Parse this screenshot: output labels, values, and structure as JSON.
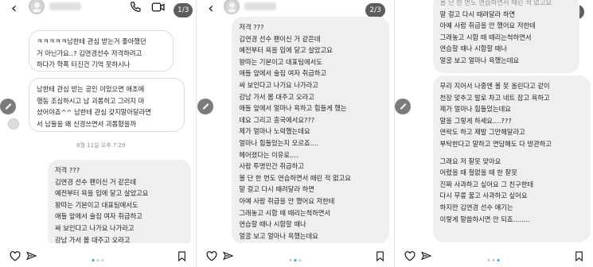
{
  "panels": [
    {
      "page": "1/3",
      "timestamp": "8월 11일 오후 7:29",
      "bubbles": [
        [
          "ㅋㅋㅋㅋㅋ남한테 관심 받는거 좋아했던",
          "거 아닌가요..? 김연경선수 저격하려고",
          "하다가 학폭 터진건 기억 못하시나"
        ],
        [
          "남한테 관심 받는 공인 이었으면 애초에",
          "행동 조심하시고 남 괴롭히고 그러지 마",
          "셨어야죠^^ 남한테 관심 갖지말아달라면",
          "서 남들을 왜 신경쓰면서 괴롭혔을까"
        ],
        [
          "저격 ???",
          "김연경 선수 팬이신 거 같은데",
          "예전부터 욕을 입에 달고 살았고요",
          "왕따는 기본이고 대표팀에서도",
          "애들 앞에서 술집 여자 취급하고",
          "싸 보인다고 나가요 나가라고",
          "강남 가서 몸 대주고 오라고"
        ]
      ]
    },
    {
      "page": "2/3",
      "bubbles": [
        [
          "저격 ???",
          "김연경 선수 팬이신 거 같은데",
          "예전부터 욕을 입에 달고 살았고요",
          "왕따는 기본이고 대표팀에서도",
          "애들 앞에서 술집 여자 취급하고",
          "싸 보인다고 나가요 나가라고",
          "강남 가서 몸 대주고 오라고",
          "애들 앞에서 얼마나 욕하고 힘들게 했는",
          "데요 그리고 흥국에서요???",
          "제가 얼마나 노력했는데요",
          "얼마나 힘들었는지 모르죠....",
          "헤어졌다는 이유로....",
          "사람 투명인간 취급하고",
          "볼 단 한 번도 연습하면서 때린 적 없고요",
          "말 걸고 다시 때려달라 하면",
          "아예 사람 취급을 안 했어요 저한테",
          "그래놓고 시합 때 때리는척하면서",
          "연습할 때나 시합할 때나",
          "얼굴 보고 얼마나 욕했는데요"
        ]
      ]
    },
    {
      "page": "3/3",
      "bubbles": [
        [
          "볼 단 한 번도 연습하면서 때린 적 없고요",
          "말 걸고 다시 때려달라 하면",
          "아예 사람 취급을 안 했어요 저한테",
          "그래놓고 시합 때 때리는척하면서",
          "연습할 때나 시합할 때나",
          "얼굴 보고 얼마나 욕했는데요"
        ],
        [
          "무리 지어서 나중엔 볼 못 올린다고 같이",
          "천장 맞추고 발로 차고 네트 잡고 욕하고",
          "제가 얼마나 힘들었는데요",
          "말을 그렇게 하세요....???",
          "연락도 하고 제발 그만해달라고",
          "부탁한다고 말하고 면담해도 다 방관하고",
          "",
          "그래요 저 잘못 맞아요",
          "어렸을 때 철없을 때 한 잘못",
          "진짜 사과하고 싶어요 그 친구한테",
          "다시 무릎 꿇고 사과하고 싶어요",
          "하지만 김연경 선수 얘기는",
          "이렇게 말씀하시면 안 되죠........"
        ]
      ]
    }
  ]
}
